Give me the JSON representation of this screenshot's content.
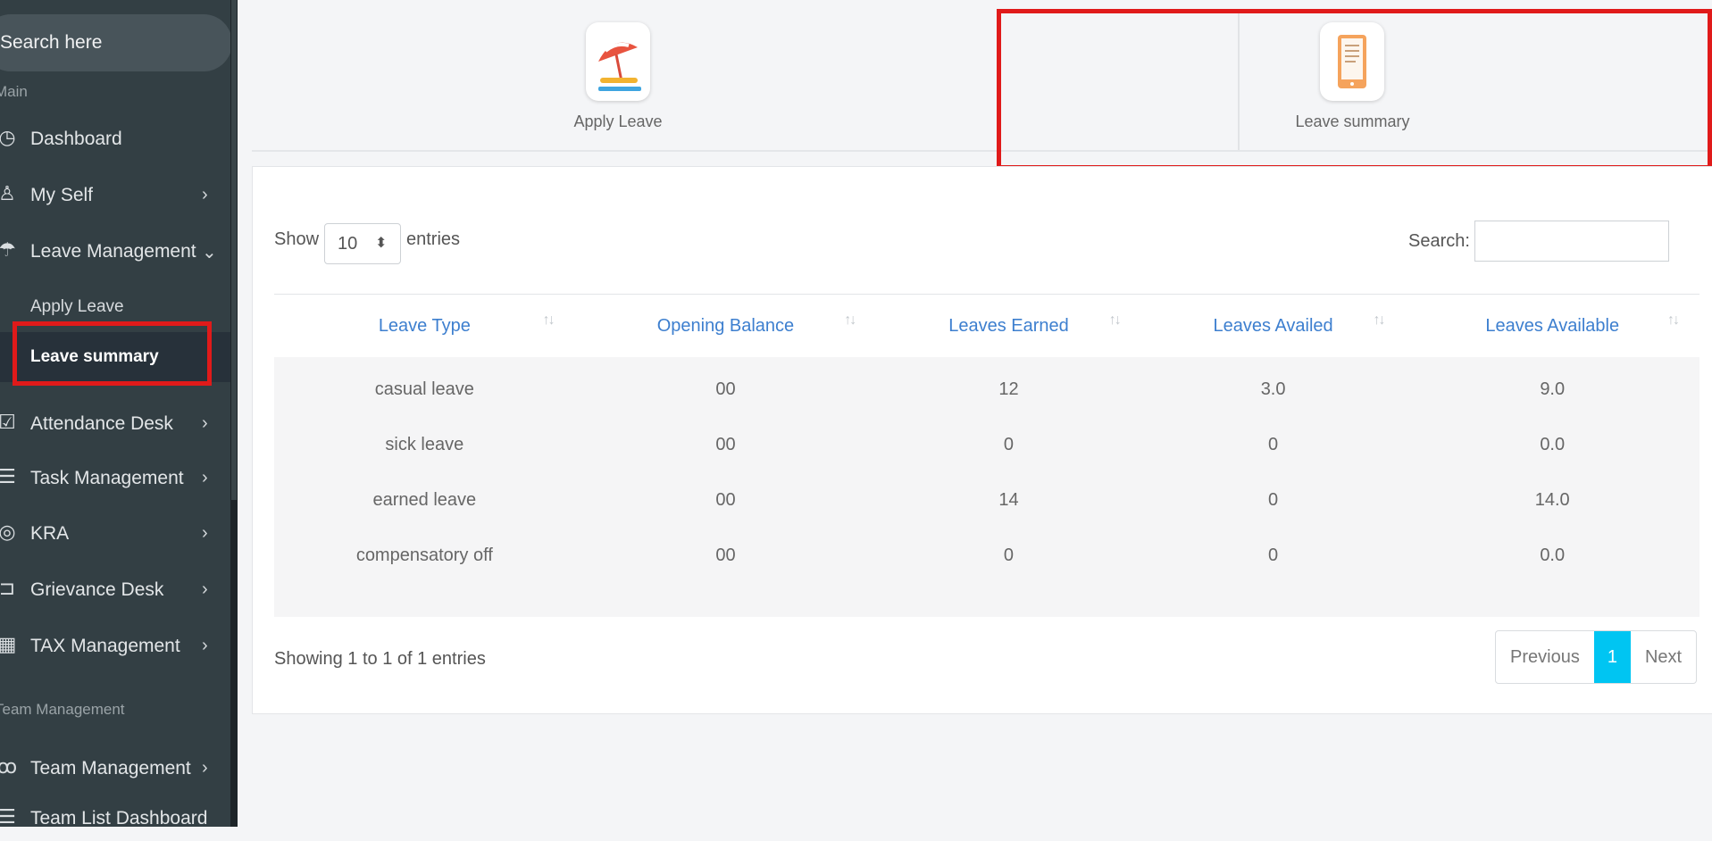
{
  "sidebar": {
    "search_placeholder": "Search here",
    "section_main": "Main",
    "items": [
      {
        "label": "Dashboard",
        "icon": "dashboard-icon"
      },
      {
        "label": "My Self",
        "icon": "user-icon"
      },
      {
        "label": "Leave Management",
        "icon": "umbrella-icon"
      },
      {
        "label": "Attendance Desk",
        "icon": "calendar-check-icon"
      },
      {
        "label": "Task Management",
        "icon": "tasks-icon"
      },
      {
        "label": "KRA",
        "icon": "target-icon"
      },
      {
        "label": "Grievance Desk",
        "icon": "ticket-icon"
      },
      {
        "label": "TAX Management",
        "icon": "calculator-icon"
      }
    ],
    "leave_sub": {
      "apply": "Apply Leave",
      "summary": "Leave summary"
    },
    "section_team": "Team Management",
    "team_items": [
      {
        "label": "Team Management",
        "icon": "team-icon"
      },
      {
        "label": "Team List Dashboard",
        "icon": "list-icon"
      }
    ]
  },
  "tabs": [
    {
      "label": "Apply Leave",
      "icon": "beach-umbrella-icon"
    },
    {
      "label": "Leave summary",
      "icon": "tablet-document-icon"
    }
  ],
  "table_controls": {
    "show": "Show",
    "page_length": "10",
    "entries": "entries",
    "search_label": "Search:"
  },
  "table": {
    "headers": [
      "Leave Type",
      "Opening Balance",
      "Leaves Earned",
      "Leaves Availed",
      "Leaves Available"
    ],
    "rows": [
      [
        "casual leave",
        "00",
        "12",
        "3.0",
        "9.0"
      ],
      [
        "sick leave",
        "00",
        "0",
        "0",
        "0.0"
      ],
      [
        "earned leave",
        "00",
        "14",
        "0",
        "14.0"
      ],
      [
        "compensatory off",
        "00",
        "0",
        "0",
        "0.0"
      ]
    ]
  },
  "footer": {
    "info": "Showing 1 to 1 of 1 entries",
    "previous": "Previous",
    "page": "1",
    "next": "Next"
  },
  "colors": {
    "sidebar_bg": "#333f44",
    "highlight": "#e01a1a",
    "header_text": "#3d7fcf",
    "pager_active": "#00c5f2"
  }
}
